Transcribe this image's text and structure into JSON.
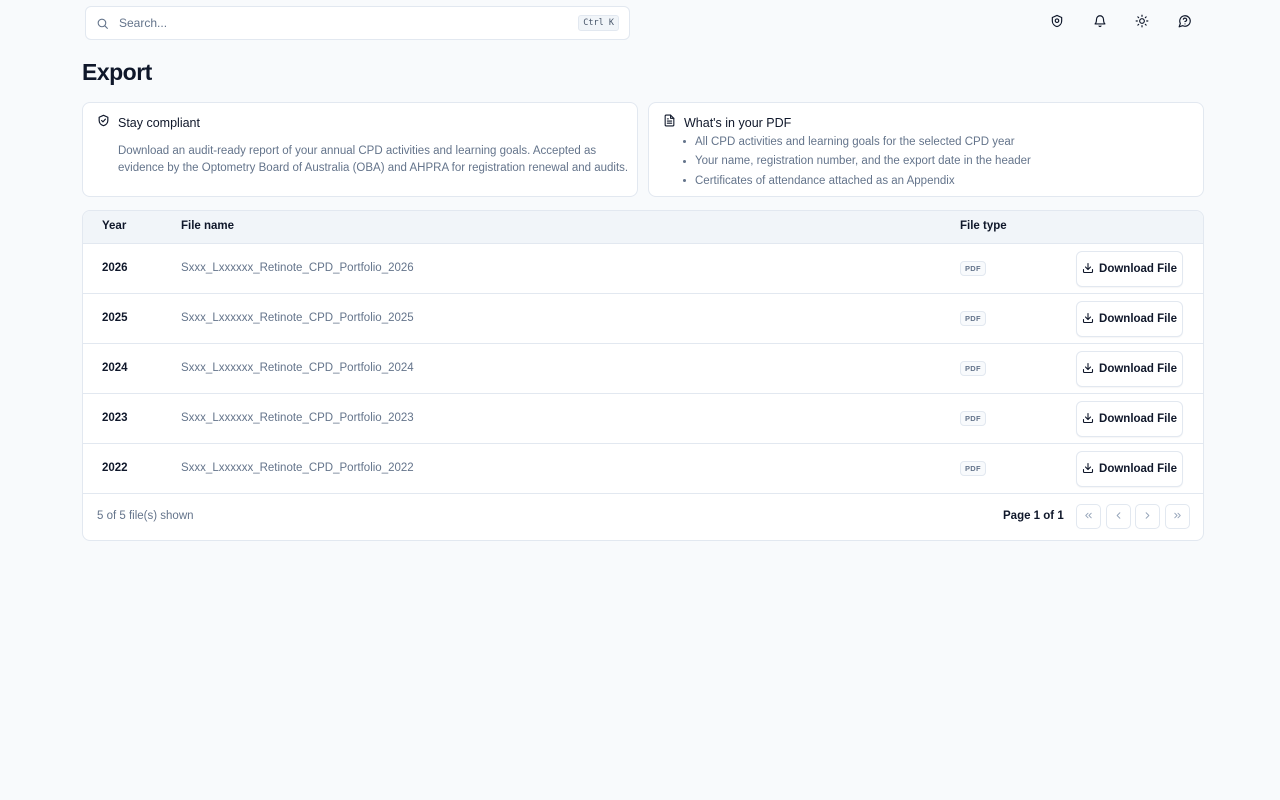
{
  "search": {
    "placeholder": "Search...",
    "shortcut": "Ctrl K"
  },
  "topbar": {
    "icons": [
      "shield-icon",
      "bell-icon",
      "sun-icon",
      "help-icon"
    ]
  },
  "page_title": "Export",
  "compliance": {
    "title": "Stay compliant",
    "description": "Download an audit-ready report of your annual CPD activities and learning goals. Accepted as evidence by the Optometry Board of Australia (OBA) and AHPRA for registration renewal and audits."
  },
  "pdf_info": {
    "title": "What's in your PDF",
    "items": [
      "All CPD activities and learning goals for the selected CPD year",
      "Your name, registration number, and the export date in the header",
      "Certificates of attendance attached as an Appendix"
    ]
  },
  "table": {
    "headers": {
      "year": "Year",
      "file_name": "File name",
      "file_type": "File type"
    },
    "rows": [
      {
        "year": "2026",
        "file_name": "Sxxx_Lxxxxxx_Retinote_CPD_Portfolio_2026",
        "file_type": "PDF",
        "action": "Download File"
      },
      {
        "year": "2025",
        "file_name": "Sxxx_Lxxxxxx_Retinote_CPD_Portfolio_2025",
        "file_type": "PDF",
        "action": "Download File"
      },
      {
        "year": "2024",
        "file_name": "Sxxx_Lxxxxxx_Retinote_CPD_Portfolio_2024",
        "file_type": "PDF",
        "action": "Download File"
      },
      {
        "year": "2023",
        "file_name": "Sxxx_Lxxxxxx_Retinote_CPD_Portfolio_2023",
        "file_type": "PDF",
        "action": "Download File"
      },
      {
        "year": "2022",
        "file_name": "Sxxx_Lxxxxxx_Retinote_CPD_Portfolio_2022",
        "file_type": "PDF",
        "action": "Download File"
      }
    ],
    "footer": {
      "count": "5 of 5 file(s) shown",
      "page": "Page 1 of 1"
    }
  },
  "colors": {
    "text": "#0f172a",
    "muted": "#64748b",
    "border": "#e2e8f0",
    "header_bg": "#f1f5f9",
    "page_bg": "#f8fafc"
  }
}
